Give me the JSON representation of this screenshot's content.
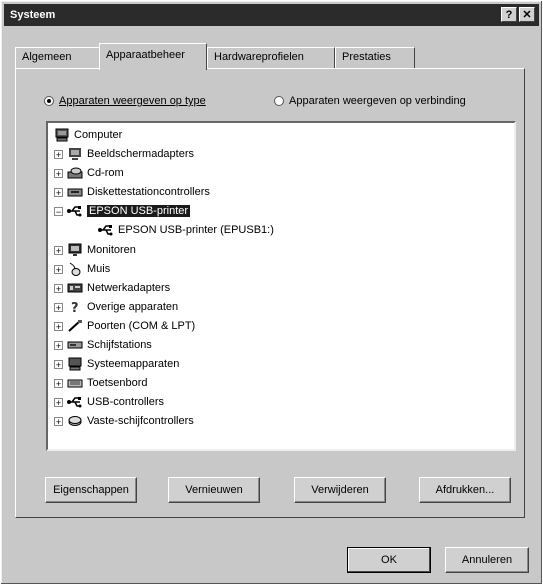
{
  "window": {
    "title": "Systeem",
    "help_glyph": "?",
    "close_glyph": "✕"
  },
  "tabs": [
    {
      "label": "Algemeen",
      "active": false
    },
    {
      "label": "Apparaatbeheer",
      "active": true
    },
    {
      "label": "Hardwareprofielen",
      "active": false
    },
    {
      "label": "Prestaties",
      "active": false
    }
  ],
  "view_options": {
    "by_type": {
      "label": "Apparaten weergeven op type",
      "checked": true
    },
    "by_connection": {
      "label": "Apparaten weergeven op verbinding",
      "checked": false
    }
  },
  "tree": {
    "root": {
      "label": "Computer",
      "icon": "computer-icon"
    },
    "items": [
      {
        "label": "Beeldschermadapters",
        "icon": "display-adapter-icon",
        "expander": "+"
      },
      {
        "label": "Cd-rom",
        "icon": "cdrom-icon",
        "expander": "+"
      },
      {
        "label": "Diskettestationcontrollers",
        "icon": "floppy-controller-icon",
        "expander": "+"
      },
      {
        "label": "EPSON USB-printer",
        "icon": "usb-icon",
        "expander": "−",
        "selected": true
      },
      {
        "label": "EPSON USB-printer (EPUSB1:)",
        "icon": "usb-icon",
        "child": true
      },
      {
        "label": "Monitoren",
        "icon": "monitor-icon",
        "expander": "+"
      },
      {
        "label": "Muis",
        "icon": "mouse-icon",
        "expander": "+"
      },
      {
        "label": "Netwerkadapters",
        "icon": "network-adapter-icon",
        "expander": "+"
      },
      {
        "label": "Overige apparaten",
        "icon": "question-icon",
        "expander": "+"
      },
      {
        "label": "Poorten (COM & LPT)",
        "icon": "port-icon",
        "expander": "+"
      },
      {
        "label": "Schijfstations",
        "icon": "disk-drive-icon",
        "expander": "+"
      },
      {
        "label": "Systeemapparaten",
        "icon": "system-device-icon",
        "expander": "+"
      },
      {
        "label": "Toetsenbord",
        "icon": "keyboard-icon",
        "expander": "+"
      },
      {
        "label": "USB-controllers",
        "icon": "usb-icon",
        "expander": "+"
      },
      {
        "label": "Vaste-schijfcontrollers",
        "icon": "hdd-controller-icon",
        "expander": "+"
      }
    ]
  },
  "actions": {
    "properties": "Eigenschappen",
    "refresh": "Vernieuwen",
    "remove": "Verwijderen",
    "print": "Afdrukken..."
  },
  "footer": {
    "ok": "OK",
    "cancel": "Annuleren"
  }
}
